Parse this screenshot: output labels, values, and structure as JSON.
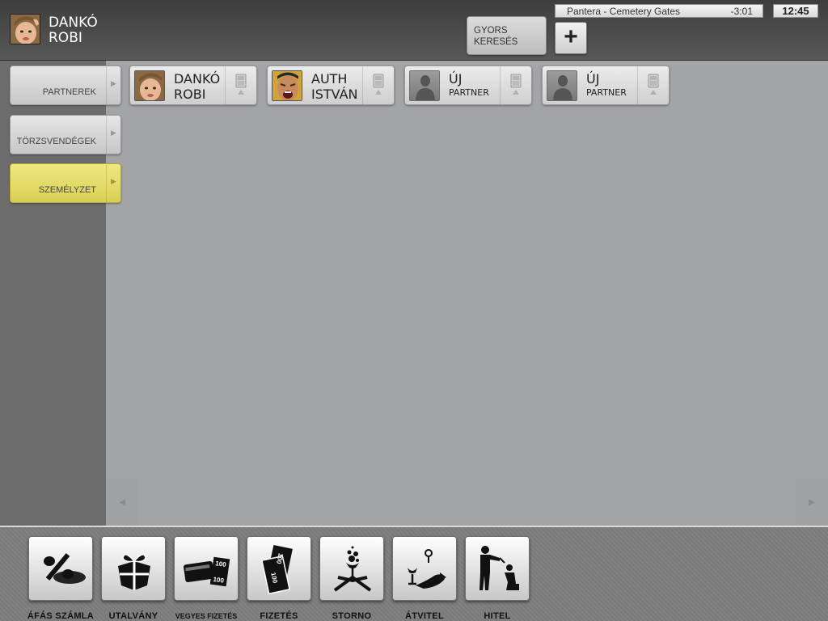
{
  "header": {
    "user": {
      "first": "DANKÓ",
      "last": "ROBI"
    },
    "quick_search": {
      "line1": "GYORS",
      "line2": "KERESÉS"
    },
    "add_label": "+",
    "now_playing": {
      "track": "Pantera - Cemetery Gates",
      "remaining": "-3:01"
    },
    "clock": "12:45"
  },
  "sidebar": {
    "items": [
      {
        "label": "PARTNEREK",
        "active": false
      },
      {
        "label": "TÖRZSVENDÉGEK",
        "active": false
      },
      {
        "label": "SZEMÉLYZET",
        "active": true
      }
    ]
  },
  "partners": [
    {
      "line1": "DANKÓ",
      "line2": "ROBI",
      "photo": "kid-portrait"
    },
    {
      "line1": "AUTH",
      "line2": "ISTVÁN",
      "photo": "shouting-man-portrait"
    },
    {
      "line1": "ÚJ",
      "line2": "PARTNER",
      "photo": "silhouette"
    },
    {
      "line1": "ÚJ",
      "line2": "PARTNER",
      "photo": "silhouette"
    }
  ],
  "toolbar": {
    "items": [
      {
        "label": "ÁFÁS SZÁMLA",
        "icon": "percent-icon"
      },
      {
        "label": "UTALVÁNY",
        "icon": "gift-icon"
      },
      {
        "label": "VEGYES FIZETÉS",
        "icon": "card-and-cash-icon"
      },
      {
        "label": "FIZETÉS",
        "icon": "banknotes-icon"
      },
      {
        "label": "STORNO",
        "icon": "spilled-glass-icon"
      },
      {
        "label": "ÁTVITEL",
        "icon": "transfer-glass-icon"
      },
      {
        "label": "HITEL",
        "icon": "credit-people-icon"
      }
    ]
  },
  "colors": {
    "active_tab": "#e4da6a",
    "content_bg": "#a3a4a6",
    "sidebar_bg": "#6c6c6c"
  }
}
